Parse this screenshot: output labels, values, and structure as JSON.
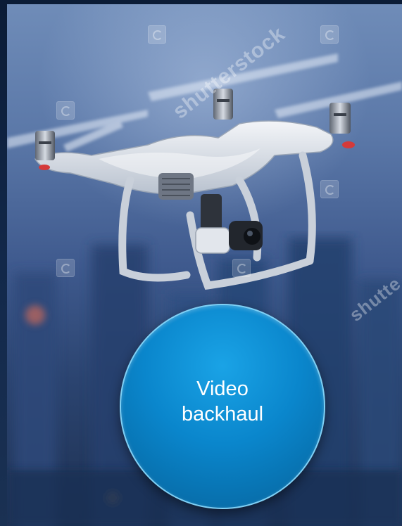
{
  "bubble": {
    "label": "Video backhaul",
    "fill_color": "#0a86cc",
    "border_color": "#7fd0f5"
  },
  "watermark": {
    "text_1": "shutterstock",
    "text_2": "shutte"
  },
  "scene": {
    "subject_icon": "quadcopter-drone-icon"
  }
}
